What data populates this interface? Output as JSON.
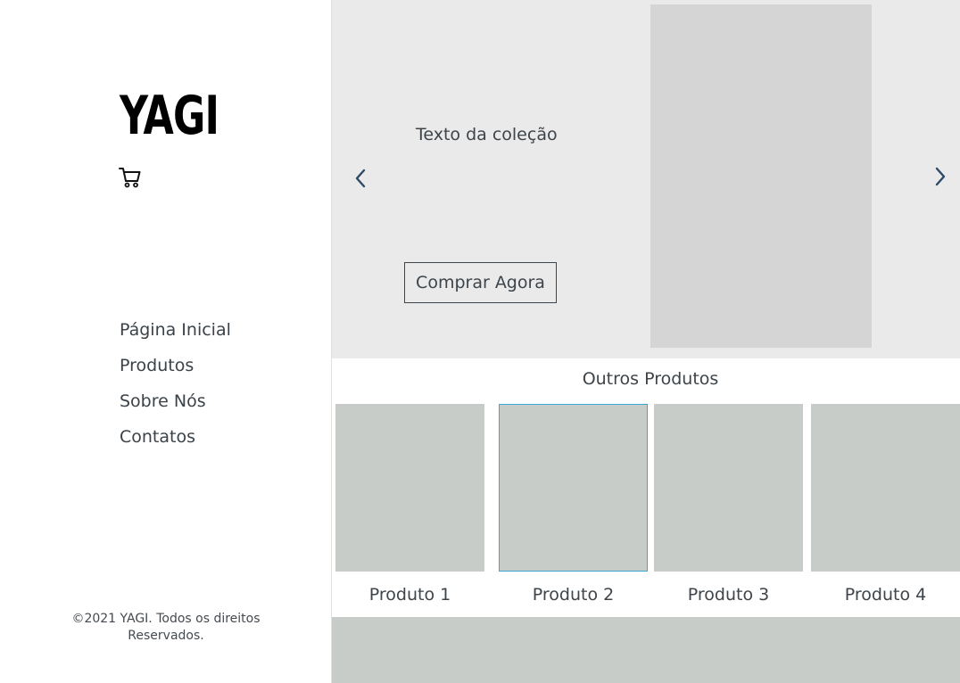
{
  "brand": {
    "logo_text": "YAGI"
  },
  "sidebar": {
    "nav_items": [
      {
        "label": "Página Inicial"
      },
      {
        "label": "Produtos"
      },
      {
        "label": "Sobre Nós"
      },
      {
        "label": "Contatos"
      }
    ],
    "footer_line1": "©2021 YAGI. Todos os direitos",
    "footer_line2": "Reservados."
  },
  "hero": {
    "collection_text": "Texto da coleção",
    "cta_label": "Comprar Agora"
  },
  "others": {
    "title": "Outros Produtos",
    "products": [
      {
        "name": "Produto 1"
      },
      {
        "name": "Produto 2"
      },
      {
        "name": "Produto 3"
      },
      {
        "name": "Produto 4"
      }
    ]
  },
  "icons": {
    "cart": "cart-icon",
    "prev": "chevron-left-icon",
    "next": "chevron-right-icon"
  },
  "colors": {
    "hero_bg": "#eaeaea",
    "hero_image_placeholder": "#d4d5d4",
    "product_placeholder": "#c7ccc8",
    "selected_border": "#3ba7d4",
    "arrow": "#2e4a66"
  }
}
